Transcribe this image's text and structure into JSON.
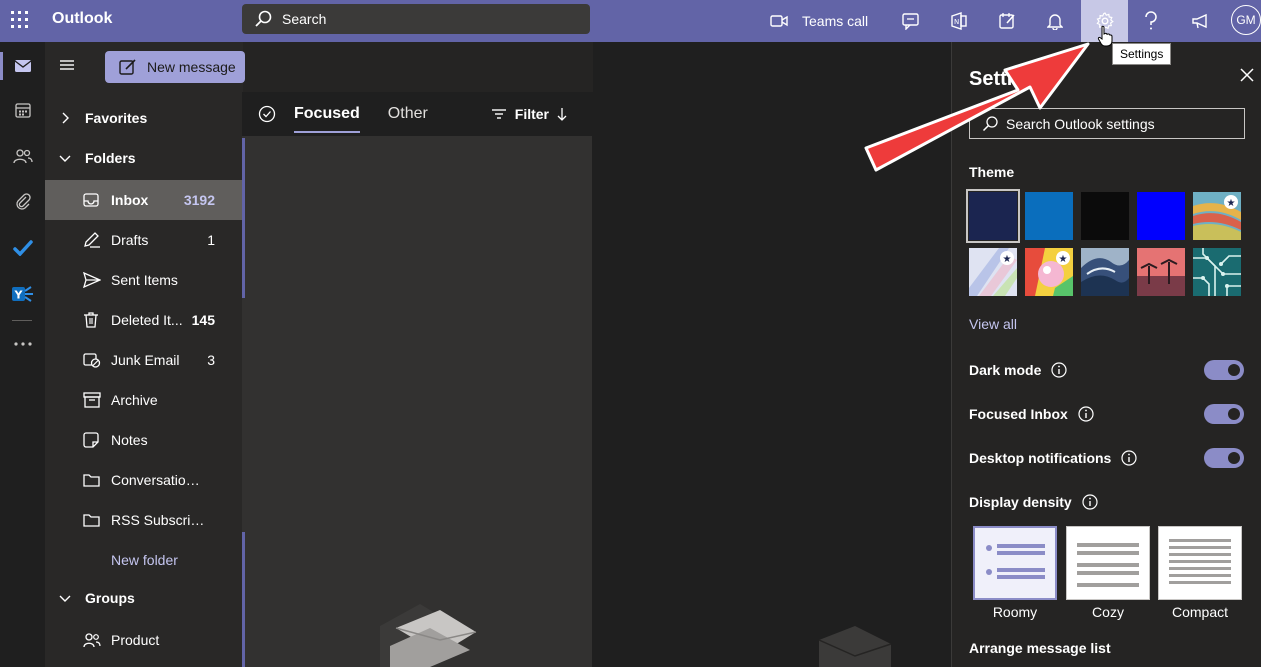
{
  "app": {
    "name": "Outlook"
  },
  "search": {
    "placeholder": "Search"
  },
  "topbar": {
    "teams_call_label": "Teams call",
    "avatar_initials": "GM",
    "settings_tooltip": "Settings"
  },
  "rail": {
    "items": [
      "mail-icon",
      "calendar-icon",
      "people-icon",
      "attachment-icon",
      "todo-icon",
      "yammer-icon",
      "more-icon"
    ]
  },
  "folderpane": {
    "new_message_label": "New message",
    "sections": {
      "favorites": "Favorites",
      "folders": "Folders",
      "groups": "Groups"
    },
    "folders": [
      {
        "name": "Inbox",
        "count": "3192",
        "icon": "inbox-icon"
      },
      {
        "name": "Drafts",
        "count": "1",
        "icon": "drafts-icon"
      },
      {
        "name": "Sent Items",
        "count": "",
        "icon": "sent-icon"
      },
      {
        "name": "Deleted It...",
        "count": "145",
        "icon": "trash-icon"
      },
      {
        "name": "Junk Email",
        "count": "3",
        "icon": "junk-icon"
      },
      {
        "name": "Archive",
        "count": "",
        "icon": "archive-icon"
      },
      {
        "name": "Notes",
        "count": "",
        "icon": "notes-icon"
      },
      {
        "name": "Conversation ...",
        "count": "",
        "icon": "folder-icon"
      },
      {
        "name": "RSS Subscripti...",
        "count": "",
        "icon": "folder-icon"
      }
    ],
    "new_folder_label": "New folder",
    "groups": [
      {
        "name": "Product",
        "icon": "group-icon"
      }
    ]
  },
  "msglist": {
    "tabs": {
      "focused": "Focused",
      "other": "Other"
    },
    "filter_label": "Filter"
  },
  "settings": {
    "title": "Settings",
    "search_placeholder": "Search Outlook settings",
    "theme_label": "Theme",
    "themes": [
      {
        "name": "dark-navy",
        "color": "#1b2550",
        "selected": true
      },
      {
        "name": "blue",
        "color": "#0a6ebd"
      },
      {
        "name": "black",
        "color": "#0b0b0b"
      },
      {
        "name": "bright-blue",
        "color": "#0000ff"
      },
      {
        "name": "rainbow",
        "color": "#d9a441",
        "starred": true
      },
      {
        "name": "pastel",
        "color": "#b9c4e8",
        "starred": true
      },
      {
        "name": "unicorn",
        "color": "#e85b9a",
        "starred": true
      },
      {
        "name": "wave",
        "color": "#37507a"
      },
      {
        "name": "palms",
        "color": "#d65b5b"
      },
      {
        "name": "circuit",
        "color": "#1a6b70"
      }
    ],
    "view_all_label": "View all",
    "dark_mode_label": "Dark mode",
    "focused_inbox_label": "Focused Inbox",
    "desktop_notifications_label": "Desktop notifications",
    "display_density_label": "Display density",
    "density_options": [
      "Roomy",
      "Cozy",
      "Compact"
    ],
    "arrange_label": "Arrange message list"
  },
  "colors": {
    "accent": "#6264a7",
    "toggle_on": "#8b8cc7",
    "annotation_arrow": "#ee3b3b"
  }
}
